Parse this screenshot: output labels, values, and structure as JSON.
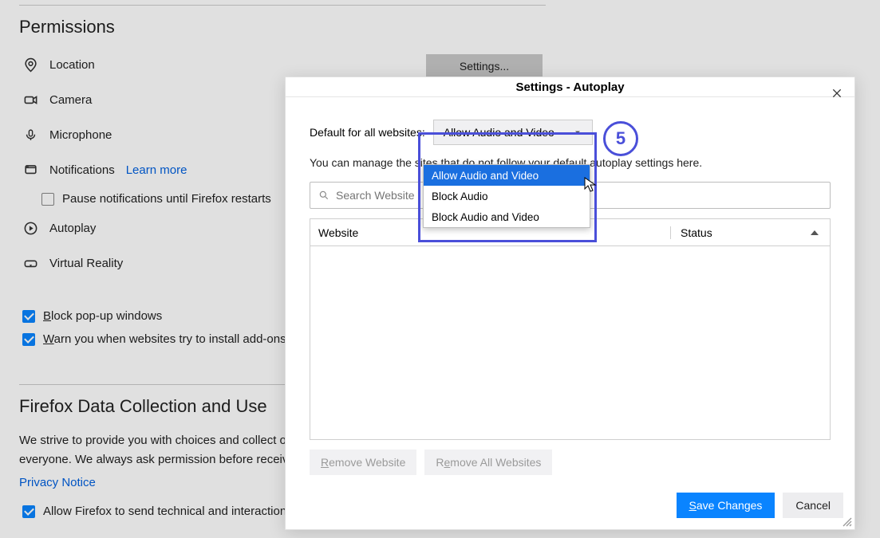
{
  "bg": {
    "section1_title": "Permissions",
    "location": "Location",
    "camera": "Camera",
    "microphone": "Microphone",
    "notifications": "Notifications",
    "learn_more": "Learn more",
    "pause_notifications": "Pause notifications until Firefox restarts",
    "autoplay": "Autoplay",
    "virtual_reality": "Virtual Reality",
    "block_popups": "Block pop-up windows",
    "warn_addons": "Warn you when websites try to install add-ons",
    "settings_btn": "Settings...",
    "section2_title": "Firefox Data Collection and Use",
    "body_text": "We strive to provide you with choices and collect only what we need to improve Firefox for everyone. We always ask permission before...",
    "privacy_notice": "Privacy Notice",
    "allow_technical": "Allow Firefox to send technical and interaction data to Mozilla"
  },
  "modal": {
    "title": "Settings - Autoplay",
    "default_label": "Default for all websites:",
    "select_value": "Allow Audio and Video",
    "desc": "You can manage the sites that do not follow your default autoplay settings here.",
    "search_placeholder": "Search Website",
    "col_website": "Website",
    "col_status": "Status",
    "remove_website": "Remove Website",
    "remove_all": "Remove All Websites",
    "save": "Save Changes",
    "cancel": "Cancel"
  },
  "dropdown": {
    "opt1": "Allow Audio and Video",
    "opt2": "Block Audio",
    "opt3": "Block Audio and Video"
  },
  "annotation": {
    "number": "5"
  }
}
